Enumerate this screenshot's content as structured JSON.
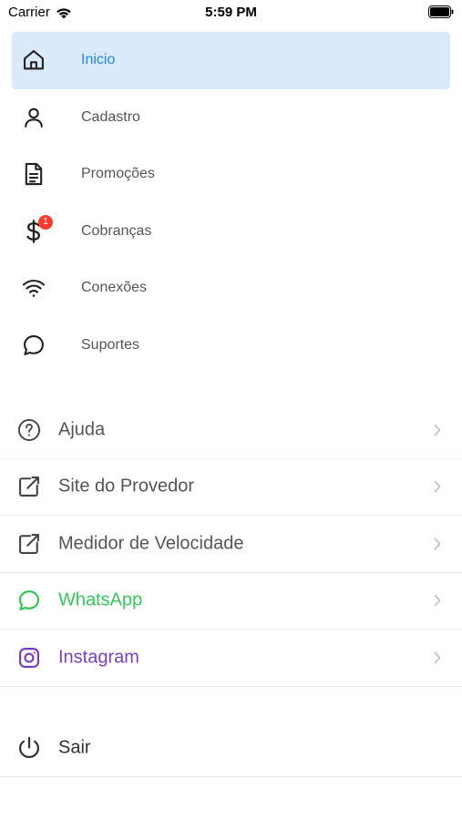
{
  "status_bar": {
    "carrier": "Carrier",
    "time": "5:59 PM"
  },
  "menu": {
    "items": [
      {
        "label": "Inicio",
        "icon": "home-icon",
        "active": true
      },
      {
        "label": "Cadastro",
        "icon": "user-icon"
      },
      {
        "label": "Promoções",
        "icon": "document-icon"
      },
      {
        "label": "Cobranças",
        "icon": "dollar-icon",
        "badge": "1"
      },
      {
        "label": "Conexões",
        "icon": "wifi-icon"
      },
      {
        "label": "Suportes",
        "icon": "chat-bubble-icon"
      }
    ]
  },
  "secondary": {
    "items": [
      {
        "label": "Ajuda",
        "icon": "help-circle-icon"
      },
      {
        "label": "Site do Provedor",
        "icon": "external-link-icon"
      },
      {
        "label": "Medidor de Velocidade",
        "icon": "external-link-icon"
      },
      {
        "label": "WhatsApp",
        "icon": "whatsapp-icon"
      },
      {
        "label": "Instagram",
        "icon": "instagram-icon"
      }
    ]
  },
  "logout": {
    "label": "Sair",
    "icon": "power-icon"
  },
  "colors": {
    "active_bg": "#dbeafb",
    "active_text": "#1e88e5",
    "whatsapp": "#34c759",
    "instagram": "#7b3fc4",
    "badge": "#ff3b30"
  }
}
